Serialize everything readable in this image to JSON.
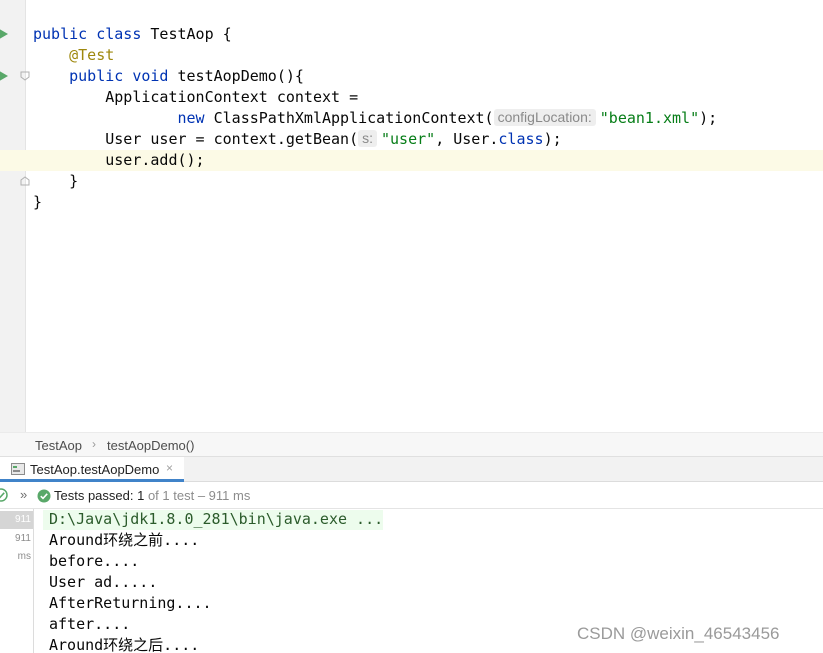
{
  "editor": {
    "lines": [
      {
        "parts": [
          [
            "kw",
            "public class "
          ],
          [
            "",
            "TestAop {"
          ]
        ]
      },
      {
        "parts": [
          [
            "",
            "    "
          ],
          [
            "ann",
            "@Test"
          ]
        ]
      },
      {
        "parts": [
          [
            "",
            "    "
          ],
          [
            "kw",
            "public void "
          ],
          [
            "",
            "testAopDemo(){"
          ]
        ]
      },
      {
        "parts": [
          [
            "",
            "        ApplicationContext context ="
          ]
        ]
      },
      {
        "parts": [
          [
            "",
            "                "
          ],
          [
            "kw",
            "new "
          ],
          [
            "",
            "ClassPathXmlApplicationContext("
          ],
          [
            "hint",
            "configLocation:"
          ],
          [
            "str",
            "\"bean1.xml\""
          ],
          [
            "",
            ");"
          ]
        ]
      },
      {
        "parts": [
          [
            "",
            "        User user = context.getBean("
          ],
          [
            "hint",
            "s:"
          ],
          [
            "str",
            "\"user\""
          ],
          [
            "",
            ", User."
          ],
          [
            "kw",
            "class"
          ],
          [
            "",
            ");"
          ]
        ]
      },
      {
        "parts": [
          [
            "",
            "        user.add();"
          ]
        ]
      },
      {
        "parts": [
          [
            "",
            "    }"
          ]
        ]
      },
      {
        "parts": [
          [
            "",
            "}"
          ]
        ]
      }
    ],
    "colors": {
      "keyword": "#0033b3",
      "annotation": "#9e880d",
      "string": "#067d17",
      "current_line": "#fcfae6"
    }
  },
  "breadcrumb": {
    "class_name": "TestAop",
    "separator": "›",
    "method_name": "testAopDemo()"
  },
  "run_panel": {
    "tab_label": "TestAop.testAopDemo",
    "tab_close": "×",
    "expand_glyph": "»",
    "status_main": "Tests passed: ",
    "status_count": "1",
    "status_detail": " of 1 test – 911 ms",
    "tree_durations": [
      "911 ms",
      "911 ms"
    ],
    "accent_color": "#4083c9",
    "success_color": "#59a869"
  },
  "console": {
    "command": "D:\\Java\\jdk1.8.0_281\\bin\\java.exe ...",
    "output": [
      "Around环绕之前....",
      "before....",
      "User ad.....",
      "AfterReturning....",
      "after....",
      "Around环绕之后...."
    ]
  },
  "watermark": "CSDN @weixin_46543456"
}
